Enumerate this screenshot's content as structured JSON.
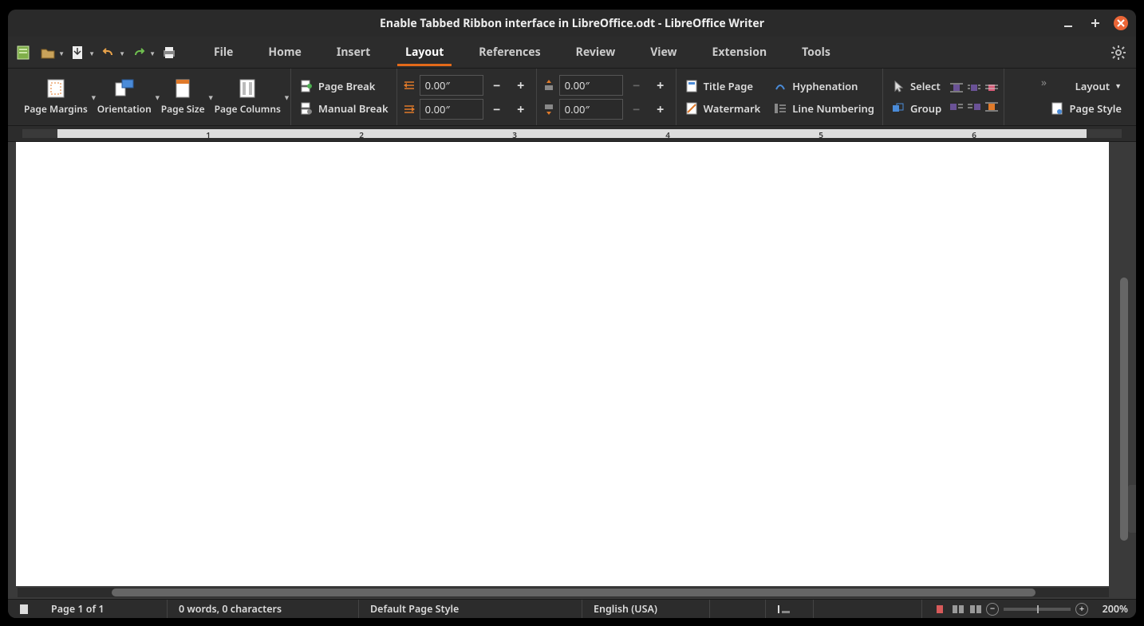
{
  "title": "Enable Tabbed Ribbon interface in LibreOffice.odt - LibreOffice Writer",
  "tabs": [
    "File",
    "Home",
    "Insert",
    "Layout",
    "References",
    "Review",
    "View",
    "Extension",
    "Tools"
  ],
  "activeTab": "Layout",
  "ribbon": {
    "pageMargins": "Page Margins",
    "orientation": "Orientation",
    "pageSize": "Page Size",
    "pageColumns": "Page Columns",
    "pageBreak": "Page Break",
    "manualBreak": "Manual Break",
    "indentLeft": "0.00″",
    "indentRight": "0.00″",
    "spaceAbove": "0.00″",
    "spaceBelow": "0.00″",
    "titlePage": "Title Page",
    "watermark": "Watermark",
    "hyphenation": "Hyphenation",
    "lineNumbering": "Line Numbering",
    "select": "Select",
    "group": "Group",
    "layoutMenu": "Layout",
    "pageStyle": "Page Style"
  },
  "rulerNumbers": [
    "1",
    "2",
    "3",
    "4",
    "5",
    "6"
  ],
  "status": {
    "page": "Page 1 of 1",
    "words": "0 words, 0 characters",
    "style": "Default Page Style",
    "lang": "English (USA)",
    "zoom": "200%"
  }
}
